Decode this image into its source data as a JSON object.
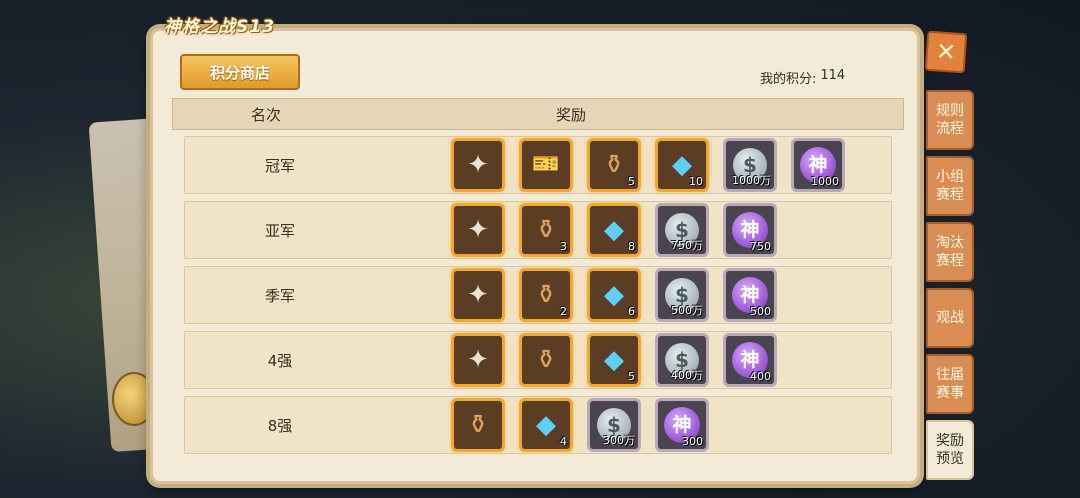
{
  "title": "神格之战S13",
  "shop_button": "积分商店",
  "score": {
    "label": "我的积分:",
    "value": "114"
  },
  "table_header": {
    "rank": "名次",
    "reward": "奖励"
  },
  "rows": [
    {
      "rank": "冠军",
      "items": [
        {
          "icon": "weapon-icon",
          "glyph": "✦",
          "style": "gold",
          "kind": "weapon",
          "count": ""
        },
        {
          "icon": "ticket-icon",
          "glyph": "🎫",
          "style": "gold",
          "kind": "ticket",
          "count": ""
        },
        {
          "icon": "chest-icon",
          "glyph": "⚱",
          "style": "gold",
          "kind": "chest",
          "count": "5"
        },
        {
          "icon": "gem-icon",
          "glyph": "◆",
          "style": "gold",
          "kind": "gem",
          "count": "10"
        },
        {
          "icon": "silver-coin-icon",
          "glyph": "$",
          "style": "grey",
          "kind": "silver",
          "count": "1000万"
        },
        {
          "icon": "shen-token-icon",
          "glyph": "神",
          "style": "grey",
          "kind": "shen",
          "count": "1000"
        }
      ]
    },
    {
      "rank": "亚军",
      "items": [
        {
          "icon": "weapon-icon",
          "glyph": "✦",
          "style": "gold",
          "kind": "weapon",
          "count": ""
        },
        {
          "icon": "chest-icon",
          "glyph": "⚱",
          "style": "gold",
          "kind": "chest",
          "count": "3"
        },
        {
          "icon": "gem-icon",
          "glyph": "◆",
          "style": "gold",
          "kind": "gem",
          "count": "8"
        },
        {
          "icon": "silver-coin-icon",
          "glyph": "$",
          "style": "grey",
          "kind": "silver",
          "count": "750万"
        },
        {
          "icon": "shen-token-icon",
          "glyph": "神",
          "style": "grey",
          "kind": "shen",
          "count": "750"
        }
      ]
    },
    {
      "rank": "季军",
      "items": [
        {
          "icon": "weapon-icon",
          "glyph": "✦",
          "style": "gold",
          "kind": "weapon",
          "count": ""
        },
        {
          "icon": "chest-icon",
          "glyph": "⚱",
          "style": "gold",
          "kind": "chest",
          "count": "2"
        },
        {
          "icon": "gem-icon",
          "glyph": "◆",
          "style": "gold",
          "kind": "gem",
          "count": "6"
        },
        {
          "icon": "silver-coin-icon",
          "glyph": "$",
          "style": "grey",
          "kind": "silver",
          "count": "500万"
        },
        {
          "icon": "shen-token-icon",
          "glyph": "神",
          "style": "grey",
          "kind": "shen",
          "count": "500"
        }
      ]
    },
    {
      "rank": "4强",
      "items": [
        {
          "icon": "weapon-icon",
          "glyph": "✦",
          "style": "gold",
          "kind": "weapon",
          "count": ""
        },
        {
          "icon": "chest-icon",
          "glyph": "⚱",
          "style": "gold",
          "kind": "chest",
          "count": ""
        },
        {
          "icon": "gem-icon",
          "glyph": "◆",
          "style": "gold",
          "kind": "gem",
          "count": "5"
        },
        {
          "icon": "silver-coin-icon",
          "glyph": "$",
          "style": "grey",
          "kind": "silver",
          "count": "400万"
        },
        {
          "icon": "shen-token-icon",
          "glyph": "神",
          "style": "grey",
          "kind": "shen",
          "count": "400"
        }
      ]
    },
    {
      "rank": "8强",
      "items": [
        {
          "icon": "chest-icon",
          "glyph": "⚱",
          "style": "gold",
          "kind": "chest",
          "count": ""
        },
        {
          "icon": "gem-icon",
          "glyph": "◆",
          "style": "gold",
          "kind": "gem",
          "count": "4"
        },
        {
          "icon": "silver-coin-icon",
          "glyph": "$",
          "style": "grey",
          "kind": "silver",
          "count": "300万"
        },
        {
          "icon": "shen-token-icon",
          "glyph": "神",
          "style": "grey",
          "kind": "shen",
          "count": "300"
        }
      ]
    }
  ],
  "close_glyph": "✕",
  "side_tabs": [
    {
      "label": "规则流程",
      "active": false
    },
    {
      "label": "小组赛程",
      "active": false
    },
    {
      "label": "淘汰赛程",
      "active": false
    },
    {
      "label": "观战",
      "active": false
    },
    {
      "label": "往届赛事",
      "active": false
    },
    {
      "label": "奖励预览",
      "active": true
    }
  ],
  "colors": {
    "gold_border": "#f2a82e",
    "tab": "#d98d52",
    "panel": "#f3ead8"
  }
}
